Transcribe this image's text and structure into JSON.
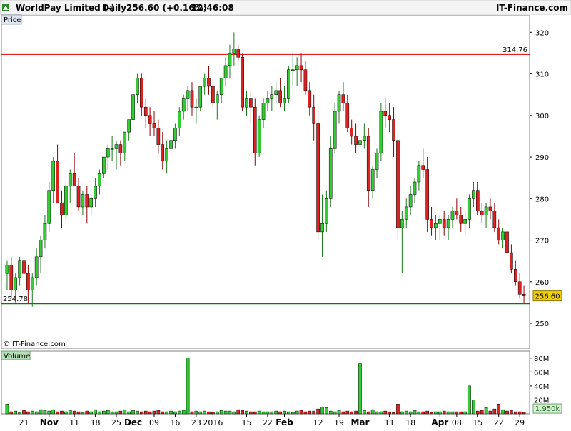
{
  "header": {
    "title": "WorldPay Limited (-)",
    "interval": "Daily",
    "quote": "256.60 (+0.16%)",
    "time": "12:46:08",
    "source": "IT-Finance.com"
  },
  "price_panel": {
    "tab_label": "Price",
    "copyright": "© IT-Finance.com",
    "resistance": {
      "value": 314.76,
      "label": "314.76",
      "color": "#e00000"
    },
    "support": {
      "value": 254.78,
      "label": "254.78",
      "color": "#008000"
    },
    "last_price": {
      "value": 256.6,
      "label": "256.60",
      "color": "#f0d000"
    }
  },
  "volume_panel": {
    "tab_label": "Volume",
    "last_volume": {
      "value": 1.95,
      "label": "1.950k"
    }
  },
  "colors": {
    "up": "#33cc33",
    "down": "#dd2222",
    "outline": "#000000",
    "accent": "#0000cc"
  },
  "chart_data": [
    {
      "type": "candlestick",
      "title": "WorldPay Limited (-)",
      "ylim": [
        244,
        324
      ],
      "yticks": [
        250,
        260,
        270,
        280,
        290,
        300,
        310,
        320
      ],
      "x_tick_labels": [
        "21",
        "Nov",
        "11",
        "18",
        "25",
        "Dec",
        "09",
        "16",
        "23",
        "2016",
        "15",
        "22",
        "Feb",
        "12",
        "19",
        "Mar",
        "11",
        "18",
        "Apr",
        "08",
        "15",
        "22",
        "29"
      ],
      "x_tick_index": [
        4,
        10,
        16,
        21,
        26,
        30,
        35,
        40,
        45,
        49,
        57,
        62,
        66,
        74,
        79,
        84,
        91,
        96,
        103,
        107,
        112,
        117,
        122
      ],
      "ohlc": [
        [
          262,
          265,
          258,
          264
        ],
        [
          264,
          266,
          256,
          258
        ],
        [
          258,
          262,
          255,
          261
        ],
        [
          261,
          266,
          259,
          265
        ],
        [
          265,
          267,
          260,
          262
        ],
        [
          262,
          264,
          255,
          258
        ],
        [
          258,
          262,
          254,
          261
        ],
        [
          261,
          268,
          259,
          266
        ],
        [
          266,
          271,
          262,
          270
        ],
        [
          270,
          276,
          268,
          274
        ],
        [
          274,
          284,
          272,
          282
        ],
        [
          282,
          290,
          279,
          289
        ],
        [
          289,
          293,
          285,
          279
        ],
        [
          279,
          282,
          273,
          276
        ],
        [
          276,
          284,
          275,
          283
        ],
        [
          283,
          287,
          279,
          286
        ],
        [
          286,
          291,
          283,
          283
        ],
        [
          283,
          285,
          277,
          278
        ],
        [
          278,
          282,
          276,
          281
        ],
        [
          281,
          283,
          274,
          278
        ],
        [
          278,
          281,
          276,
          280
        ],
        [
          280,
          285,
          278,
          283
        ],
        [
          283,
          287,
          281,
          286
        ],
        [
          286,
          290,
          285,
          290
        ],
        [
          290,
          293,
          287,
          292
        ],
        [
          292,
          295,
          289,
          292
        ],
        [
          292,
          294,
          287,
          293
        ],
        [
          293,
          294,
          288,
          291
        ],
        [
          291,
          296,
          289,
          296
        ],
        [
          296,
          299,
          294,
          299
        ],
        [
          299,
          305,
          297,
          305
        ],
        [
          305,
          310,
          303,
          309
        ],
        [
          309,
          310,
          300,
          302
        ],
        [
          302,
          304,
          297,
          300
        ],
        [
          300,
          302,
          295,
          298
        ],
        [
          298,
          301,
          295,
          297
        ],
        [
          297,
          299,
          291,
          293
        ],
        [
          293,
          296,
          287,
          289
        ],
        [
          289,
          294,
          286,
          292
        ],
        [
          292,
          296,
          290,
          294
        ],
        [
          294,
          298,
          292,
          297
        ],
        [
          297,
          302,
          295,
          301
        ],
        [
          301,
          305,
          299,
          304
        ],
        [
          304,
          307,
          301,
          306
        ],
        [
          306,
          308,
          300,
          302
        ],
        [
          302,
          304,
          298,
          302
        ],
        [
          302,
          307,
          301,
          307
        ],
        [
          307,
          310,
          305,
          309
        ],
        [
          309,
          312,
          305,
          307
        ],
        [
          307,
          308,
          302,
          303
        ],
        [
          303,
          306,
          299,
          305
        ],
        [
          305,
          309,
          303,
          309
        ],
        [
          309,
          314,
          307,
          312
        ],
        [
          312,
          317,
          309,
          315
        ],
        [
          315,
          320,
          312,
          316
        ],
        [
          316,
          317,
          313,
          314
        ],
        [
          314,
          315,
          301,
          302
        ],
        [
          302,
          306,
          300,
          304
        ],
        [
          304,
          306,
          298,
          302
        ],
        [
          302,
          304,
          288,
          291
        ],
        [
          291,
          300,
          290,
          299
        ],
        [
          299,
          304,
          297,
          303
        ],
        [
          303,
          306,
          301,
          304
        ],
        [
          304,
          307,
          301,
          305
        ],
        [
          305,
          308,
          303,
          306
        ],
        [
          306,
          309,
          302,
          303
        ],
        [
          303,
          307,
          301,
          304
        ],
        [
          304,
          312,
          303,
          311
        ],
        [
          311,
          315,
          307,
          311
        ],
        [
          311,
          314,
          307,
          312
        ],
        [
          312,
          315,
          308,
          311
        ],
        [
          311,
          313,
          305,
          306
        ],
        [
          306,
          308,
          300,
          302
        ],
        [
          302,
          305,
          294,
          298
        ],
        [
          298,
          301,
          270,
          272
        ],
        [
          272,
          281,
          266,
          274
        ],
        [
          274,
          282,
          272,
          280
        ],
        [
          280,
          295,
          278,
          292
        ],
        [
          292,
          303,
          291,
          301
        ],
        [
          301,
          306,
          298,
          305
        ],
        [
          305,
          308,
          301,
          303
        ],
        [
          303,
          305,
          296,
          297
        ],
        [
          297,
          299,
          293,
          295
        ],
        [
          295,
          298,
          291,
          293
        ],
        [
          293,
          296,
          290,
          294
        ],
        [
          294,
          298,
          292,
          295
        ],
        [
          295,
          297,
          278,
          282
        ],
        [
          282,
          288,
          280,
          287
        ],
        [
          287,
          292,
          285,
          291
        ],
        [
          291,
          303,
          289,
          301
        ],
        [
          301,
          304,
          297,
          300
        ],
        [
          300,
          303,
          296,
          299
        ],
        [
          299,
          302,
          290,
          294
        ],
        [
          294,
          296,
          270,
          273
        ],
        [
          273,
          277,
          262,
          275
        ],
        [
          275,
          280,
          273,
          278
        ],
        [
          278,
          283,
          276,
          281
        ],
        [
          281,
          285,
          279,
          284
        ],
        [
          284,
          289,
          282,
          288
        ],
        [
          288,
          292,
          285,
          287
        ],
        [
          287,
          290,
          272,
          275
        ],
        [
          275,
          278,
          271,
          273
        ],
        [
          273,
          276,
          270,
          274
        ],
        [
          274,
          276,
          270,
          275
        ],
        [
          275,
          277,
          271,
          273
        ],
        [
          273,
          276,
          270,
          275
        ],
        [
          275,
          278,
          273,
          277
        ],
        [
          277,
          280,
          275,
          276
        ],
        [
          276,
          278,
          272,
          274
        ],
        [
          274,
          277,
          271,
          275
        ],
        [
          275,
          281,
          273,
          280
        ],
        [
          280,
          284,
          278,
          282
        ],
        [
          282,
          284,
          276,
          277
        ],
        [
          277,
          279,
          274,
          276
        ],
        [
          276,
          279,
          273,
          278
        ],
        [
          278,
          280,
          275,
          277
        ],
        [
          277,
          279,
          272,
          273
        ],
        [
          273,
          275,
          269,
          270
        ],
        [
          270,
          273,
          268,
          272
        ],
        [
          272,
          274,
          266,
          267
        ],
        [
          267,
          269,
          262,
          263
        ],
        [
          263,
          265,
          259,
          260
        ],
        [
          260,
          262,
          256,
          257
        ],
        [
          257,
          259,
          255,
          256.6
        ]
      ]
    },
    {
      "type": "bar",
      "title": "Volume",
      "unit": "M",
      "ylim": [
        0,
        90
      ],
      "yticks": [
        20,
        40,
        60,
        80
      ],
      "ytick_labels": [
        "20M",
        "40M",
        "60M",
        "80M"
      ],
      "volumes": [
        14,
        3,
        4,
        2,
        5,
        3,
        4,
        3,
        6,
        5,
        4,
        6,
        3,
        4,
        3,
        5,
        4,
        3,
        2,
        4,
        3,
        6,
        3,
        4,
        5,
        3,
        3,
        4,
        6,
        3,
        5,
        4,
        3,
        4,
        3,
        4,
        5,
        3,
        3,
        4,
        3,
        4,
        5,
        80,
        3,
        4,
        3,
        4,
        3,
        2,
        3,
        5,
        4,
        4,
        3,
        6,
        5,
        4,
        3,
        3,
        4,
        3,
        3,
        3,
        4,
        3,
        4,
        3,
        2,
        4,
        5,
        3,
        4,
        4,
        7,
        10,
        9,
        4,
        3,
        5,
        3,
        4,
        3,
        4,
        72,
        5,
        3,
        6,
        3,
        3,
        4,
        3,
        2,
        14,
        3,
        4,
        3,
        5,
        3,
        3,
        4,
        2,
        3,
        3,
        4,
        3,
        3,
        3,
        3,
        3,
        40,
        20,
        4,
        5,
        9,
        4,
        7,
        14,
        6,
        4,
        5,
        3,
        3,
        2
      ]
    }
  ]
}
